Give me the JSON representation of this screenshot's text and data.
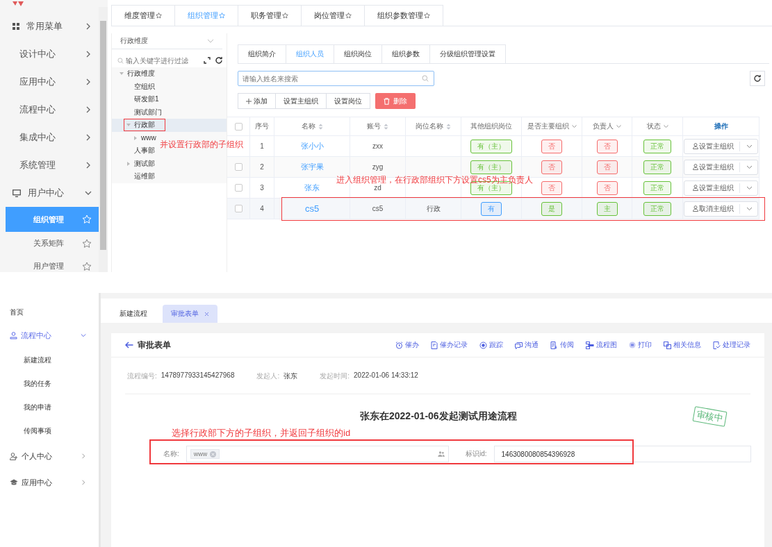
{
  "top": {
    "sidebar": {
      "items": [
        {
          "kind": "section",
          "label": "常用菜单",
          "expanded": false
        },
        {
          "kind": "group",
          "label": "设计中心",
          "expanded": false
        },
        {
          "kind": "group",
          "label": "应用中心",
          "expanded": false
        },
        {
          "kind": "group",
          "label": "流程中心",
          "expanded": false
        },
        {
          "kind": "group",
          "label": "集成中心",
          "expanded": false
        },
        {
          "kind": "group",
          "label": "系统管理",
          "expanded": false
        },
        {
          "kind": "section",
          "label": "用户中心",
          "expanded": true
        },
        {
          "kind": "sub",
          "label": "组织管理",
          "selected": true
        },
        {
          "kind": "sub",
          "label": "关系矩阵",
          "selected": false
        },
        {
          "kind": "sub",
          "label": "用户管理",
          "selected": false
        }
      ]
    },
    "tabs": [
      {
        "label": "维度管理",
        "selected": false
      },
      {
        "label": "组织管理",
        "selected": true
      },
      {
        "label": "职务管理",
        "selected": false
      },
      {
        "label": "岗位管理",
        "selected": false
      },
      {
        "label": "组织参数管理",
        "selected": false
      }
    ],
    "tree": {
      "dimension": "行政维度",
      "filter_placeholder": "输入关键字进行过滤",
      "nodes": [
        {
          "label": "行政维度",
          "kind": "branch",
          "expanded": true,
          "selected": false,
          "annotated": false,
          "children": [
            {
              "label": "空组织",
              "kind": "leaf",
              "selected": false,
              "annotated": false
            },
            {
              "label": "研发部1",
              "kind": "leaf",
              "selected": false,
              "annotated": false
            },
            {
              "label": "测试部门",
              "kind": "leaf",
              "selected": false,
              "annotated": false
            },
            {
              "label": "行政部",
              "kind": "branch",
              "expanded": true,
              "selected": true,
              "annotated": true,
              "children": [
                {
                  "label": "www",
                  "kind": "branch",
                  "expanded": false,
                  "selected": false,
                  "annotated": false
                }
              ]
            },
            {
              "label": "人事部",
              "kind": "leaf",
              "selected": false,
              "annotated": false
            },
            {
              "label": "测试部",
              "kind": "branch",
              "expanded": false,
              "selected": false,
              "annotated": false
            },
            {
              "label": "运维部",
              "kind": "leaf",
              "selected": false,
              "annotated": false
            }
          ]
        }
      ]
    },
    "tree_note": "并设置行政部的子组织",
    "content": {
      "tabs": [
        {
          "label": "组织简介",
          "selected": false
        },
        {
          "label": "组织人员",
          "selected": true
        },
        {
          "label": "组织岗位",
          "selected": false
        },
        {
          "label": "组织参数",
          "selected": false
        },
        {
          "label": "分级组织管理设置",
          "selected": false
        }
      ],
      "search_placeholder": "请输入姓名来搜索",
      "buttons": [
        {
          "label": "添加",
          "kind": "add"
        },
        {
          "label": "设置主组织",
          "kind": "plain"
        },
        {
          "label": "设置岗位",
          "kind": "plain"
        },
        {
          "label": "删除",
          "kind": "danger"
        }
      ],
      "table": {
        "all_checked": false,
        "columns": [
          {
            "label": "序号",
            "kind": "plain"
          },
          {
            "label": "名称",
            "kind": "sort"
          },
          {
            "label": "账号",
            "kind": "sort"
          },
          {
            "label": "岗位名称",
            "kind": "sort"
          },
          {
            "label": "其他组织岗位",
            "kind": "plain"
          },
          {
            "label": "是否主要组织",
            "kind": "filter"
          },
          {
            "label": "负责人",
            "kind": "filter"
          },
          {
            "label": "状态",
            "kind": "filter"
          },
          {
            "label": "操作",
            "kind": "action"
          }
        ],
        "rows": [
          {
            "selected": false,
            "annotated": false,
            "no": "1",
            "name": "张小小",
            "account": "zxx",
            "other": {
              "text": "有（主）",
              "color": "#67c23a"
            },
            "main": {
              "text": "否",
              "color": "#f56c6c"
            },
            "leader": {
              "text": "否",
              "color": "#f56c6c"
            },
            "status": {
              "text": "正常",
              "color": "#67c23a"
            },
            "action": "设置主组织"
          },
          {
            "checked": false,
            "selected": false,
            "annotated": false,
            "no": "2",
            "name": "张宇果",
            "account": "zyg",
            "other": {
              "text": "有（主）",
              "color": "#67c23a"
            },
            "main": {
              "text": "否",
              "color": "#f56c6c"
            },
            "leader": {
              "text": "否",
              "color": "#f56c6c"
            },
            "status": {
              "text": "正常",
              "color": "#67c23a"
            },
            "action": "设置主组织"
          },
          {
            "checked": false,
            "selected": false,
            "annotated": false,
            "no": "3",
            "name": "张东",
            "account": "zd",
            "other": {
              "text": "有（主）",
              "color": "#67c23a"
            },
            "main": {
              "text": "否",
              "color": "#f56c6c"
            },
            "leader": {
              "text": "否",
              "color": "#f56c6c"
            },
            "status": {
              "text": "正常",
              "color": "#67c23a"
            },
            "action": "设置主组织"
          },
          {
            "checked": false,
            "selected": true,
            "annotated": true,
            "no": "4",
            "name": "cs5",
            "account": "cs5",
            "post": "行政",
            "other": {
              "text": "有",
              "color": "#409eff"
            },
            "main": {
              "text": "是",
              "color": "#67c23a"
            },
            "leader": {
              "text": "主",
              "color": "#67c23a"
            },
            "status": {
              "text": "正常",
              "color": "#67c23a"
            },
            "action": "取消主组织"
          }
        ]
      }
    },
    "table_note": "进入组织管理，在行政部组织下方设置cs5为主负责人"
  },
  "bottom": {
    "sidebar": {
      "items": [
        {
          "kind": "link",
          "label": "首页",
          "selected": false
        },
        {
          "kind": "group",
          "label": "流程中心",
          "expanded": true,
          "selected": true,
          "children": [
            {
              "label": "新建流程"
            },
            {
              "label": "我的任务"
            },
            {
              "label": "我的申请"
            },
            {
              "label": "传阅事项"
            }
          ]
        },
        {
          "kind": "group",
          "label": "个人中心",
          "expanded": false,
          "selected": false
        },
        {
          "kind": "group",
          "label": "应用中心",
          "expanded": false,
          "selected": false
        }
      ]
    },
    "tabs": [
      {
        "label": "新建流程",
        "selected": false,
        "closable": false
      },
      {
        "label": "审批表单",
        "selected": true,
        "closable": true
      }
    ],
    "page_title": "审批表单",
    "actions": [
      "催办",
      "催办记录",
      "跟踪",
      "沟通",
      "传阅",
      "流程图",
      "打印",
      "相关信息",
      "处理记录"
    ],
    "meta": [
      {
        "label": "流程编号:",
        "value": "1478977933145427968"
      },
      {
        "label": "发起人:",
        "value": "张东"
      },
      {
        "label": "发起时间:",
        "value": "2022-01-06 14:33:12"
      }
    ],
    "title": "张东在2022-01-06发起测试用途流程",
    "stamp": "审核中",
    "form_note": "选择行政部下方的子组织，并返回子组织的id",
    "fields": [
      {
        "label": "名称:",
        "kind": "tags",
        "tags": [
          "www"
        ]
      },
      {
        "label": "标识id:",
        "kind": "text",
        "value": "1463080080854396928"
      }
    ]
  }
}
